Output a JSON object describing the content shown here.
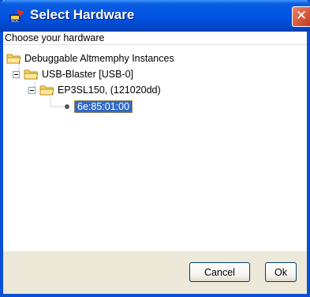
{
  "window": {
    "title": "Select Hardware"
  },
  "panel": {
    "header": "Choose your hardware"
  },
  "tree": {
    "root": "Debuggable Altmemphy Instances",
    "blaster": "USB-Blaster [USB-0]",
    "device": "EP3SL150, (121020dd)",
    "instance": "6e:85:01:00"
  },
  "buttons": {
    "cancel": "Cancel",
    "ok": "Ok"
  },
  "colors": {
    "selection": "#316ac5",
    "titlebar": "#0054e3"
  }
}
